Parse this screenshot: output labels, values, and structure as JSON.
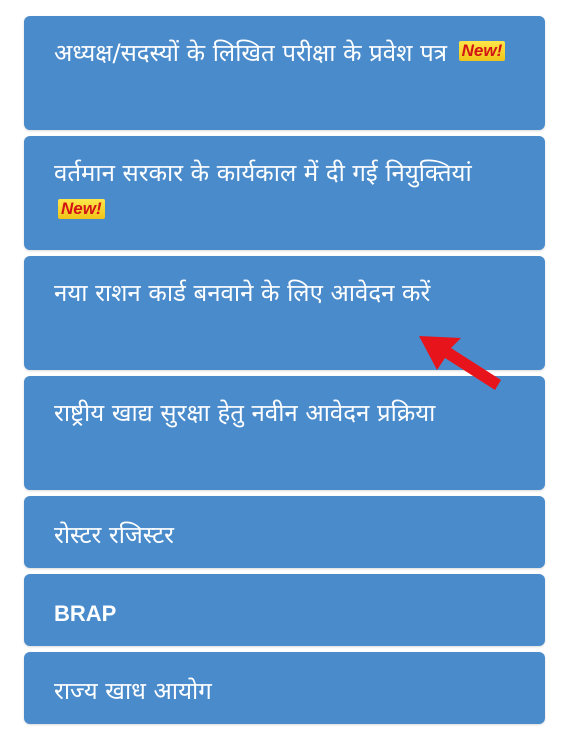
{
  "menu": {
    "items": [
      {
        "label": "अध्यक्ष/सदस्यों के लिखित परीक्षा के प्रवेश पत्र",
        "badge": "New!"
      },
      {
        "label": "वर्तमान सरकार के कार्यकाल में दी गई नियुक्तियां",
        "badge": "New!"
      },
      {
        "label": "नया राशन कार्ड बनवाने के लिए आवेदन करें"
      },
      {
        "label": "राष्ट्रीय खाद्य सुरक्षा हेतु नवीन आवेदन प्रक्रिया"
      },
      {
        "label": "रोस्टर रजिस्टर"
      },
      {
        "label": "BRAP"
      },
      {
        "label": "राज्य खाध आयोग"
      }
    ]
  },
  "colors": {
    "item_background": "#4a8bcb",
    "item_text": "#ffffff",
    "badge_text": "#d21414",
    "badge_background": "#f5d92c",
    "arrow": "#e8141c"
  },
  "icons": {
    "annotation_arrow": "red-arrow-icon"
  }
}
